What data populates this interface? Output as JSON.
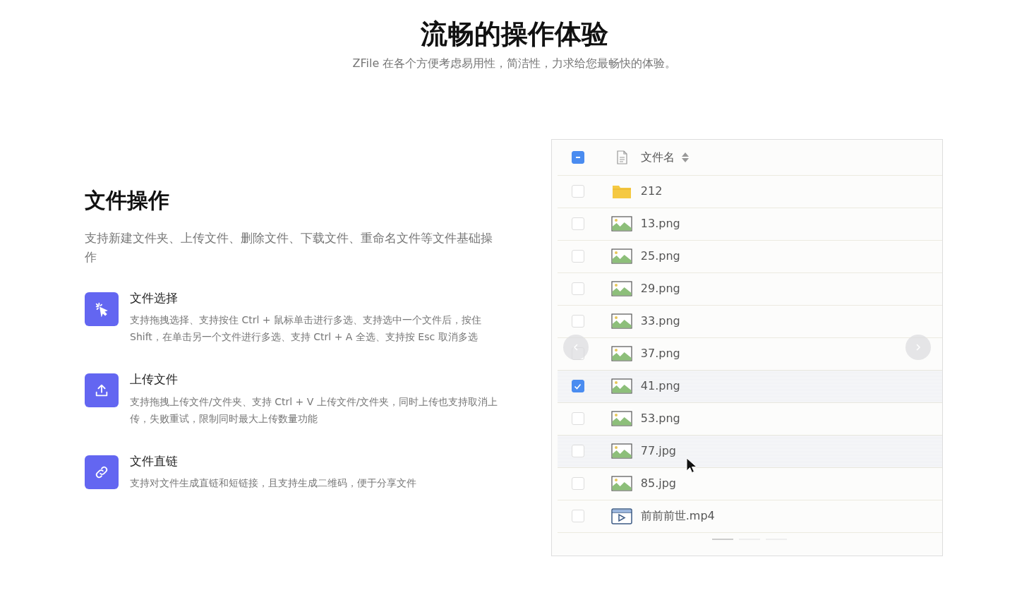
{
  "section": {
    "title": "流畅的操作体验",
    "subtitle": "ZFile 在各个方便考虑易用性，简洁性，力求给您最畅快的体验。"
  },
  "intro": {
    "title": "文件操作",
    "description": "支持新建文件夹、上传文件、删除文件、下载文件、重命名文件等文件基础操作"
  },
  "features": [
    {
      "kind": "select",
      "title": "文件选择",
      "description": "支持拖拽选择、支持按住 Ctrl + 鼠标单击进行多选、支持选中一个文件后，按住 Shift，在单击另一个文件进行多选、支持 Ctrl + A 全选、支持按 Esc 取消多选"
    },
    {
      "kind": "upload",
      "title": "上传文件",
      "description": "支持拖拽上传文件/文件夹、支持 Ctrl + V 上传文件/文件夹，同时上传也支持取消上传，失败重试，限制同时最大上传数量功能"
    },
    {
      "kind": "link",
      "title": "文件直链",
      "description": "支持对文件生成直链和短链接，且支持生成二维码，便于分享文件"
    }
  ],
  "file_table": {
    "header": {
      "label": "文件名",
      "indeterminate": true
    },
    "rows": [
      {
        "kind": "folder",
        "name": "212",
        "checked": false,
        "highlighted": false
      },
      {
        "kind": "image",
        "name": "13.png",
        "checked": false,
        "highlighted": false
      },
      {
        "kind": "image",
        "name": "25.png",
        "checked": false,
        "highlighted": false
      },
      {
        "kind": "image",
        "name": "29.png",
        "checked": false,
        "highlighted": false
      },
      {
        "kind": "image",
        "name": "33.png",
        "checked": false,
        "highlighted": false
      },
      {
        "kind": "image",
        "name": "37.png",
        "checked": false,
        "highlighted": false
      },
      {
        "kind": "image",
        "name": "41.png",
        "checked": true,
        "highlighted": true
      },
      {
        "kind": "image",
        "name": "53.png",
        "checked": false,
        "highlighted": false
      },
      {
        "kind": "image",
        "name": "77.jpg",
        "checked": false,
        "highlighted": true
      },
      {
        "kind": "image",
        "name": "85.jpg",
        "checked": false,
        "highlighted": false
      },
      {
        "kind": "video",
        "name": "前前前世.mp4",
        "checked": false,
        "highlighted": false
      }
    ]
  },
  "carousel": {
    "indicators": [
      {
        "selected": true
      },
      {
        "selected": false
      },
      {
        "selected": false
      }
    ]
  }
}
